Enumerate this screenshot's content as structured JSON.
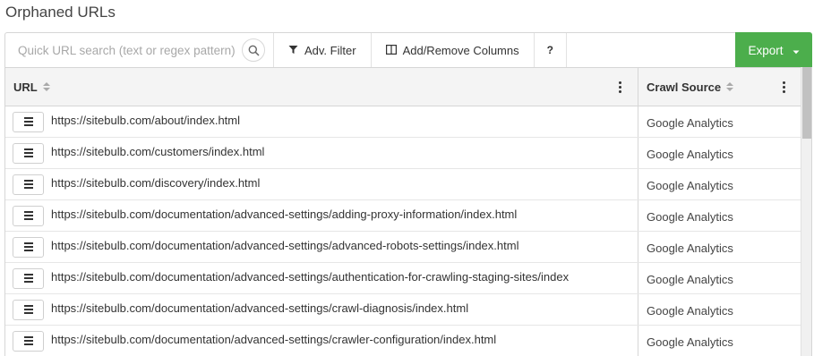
{
  "page": {
    "title": "Orphaned URLs"
  },
  "toolbar": {
    "search_placeholder": "Quick URL search (text or regex pattern)",
    "adv_filter_label": "Adv. Filter",
    "columns_label": "Add/Remove Columns",
    "help_label": "?",
    "export_label": "Export",
    "export_color": "#4cae4c"
  },
  "table": {
    "columns": [
      "URL",
      "Crawl Source"
    ],
    "rows": [
      {
        "url": "https://sitebulb.com/about/index.html",
        "source": "Google Analytics"
      },
      {
        "url": "https://sitebulb.com/customers/index.html",
        "source": "Google Analytics"
      },
      {
        "url": "https://sitebulb.com/discovery/index.html",
        "source": "Google Analytics"
      },
      {
        "url": "https://sitebulb.com/documentation/advanced-settings/adding-proxy-information/index.html",
        "source": "Google Analytics"
      },
      {
        "url": "https://sitebulb.com/documentation/advanced-settings/advanced-robots-settings/index.html",
        "source": "Google Analytics"
      },
      {
        "url": "https://sitebulb.com/documentation/advanced-settings/authentication-for-crawling-staging-sites/index",
        "source": "Google Analytics"
      },
      {
        "url": "https://sitebulb.com/documentation/advanced-settings/crawl-diagnosis/index.html",
        "source": "Google Analytics"
      },
      {
        "url": "https://sitebulb.com/documentation/advanced-settings/crawler-configuration/index.html",
        "source": "Google Analytics"
      }
    ]
  }
}
